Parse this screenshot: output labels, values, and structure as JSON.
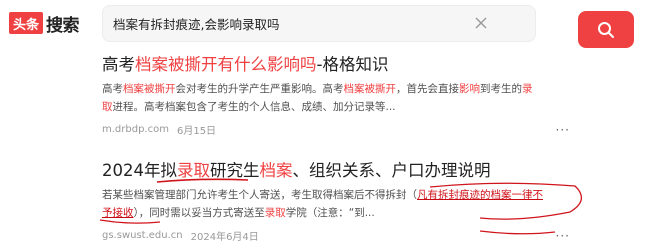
{
  "header": {
    "logo_box": "头条",
    "logo_text": "搜索",
    "search_value": "档案有拆封痕迹,会影响录取吗",
    "clear_icon": "close-icon",
    "search_icon": "search-icon"
  },
  "colors": {
    "accent": "#f04142",
    "annotation": "#d0141b"
  },
  "results": [
    {
      "title_segments": [
        {
          "text": "高考",
          "hl": false
        },
        {
          "text": "档案被撕开有什么影响吗",
          "hl": true
        },
        {
          "text": "-格格知识",
          "hl": false
        }
      ],
      "snippet_line1": [
        {
          "text": "高考",
          "hl": false
        },
        {
          "text": "档案被撕开",
          "hl": true
        },
        {
          "text": "会对考生的升学产生严重影响。高考",
          "hl": false
        },
        {
          "text": "档案被撕开",
          "hl": true
        },
        {
          "text": "，首先会直接",
          "hl": false
        },
        {
          "text": "影响",
          "hl": true
        },
        {
          "text": "到考生的",
          "hl": false
        },
        {
          "text": "录",
          "hl": true
        }
      ],
      "snippet_line2": [
        {
          "text": "取",
          "hl": true
        },
        {
          "text": "进程。高考档案包含了考生的个人信息、成绩、加分记录等...",
          "hl": false
        }
      ],
      "source": "m.drbdp.com",
      "date": "6月15日",
      "more": "···"
    },
    {
      "title_segments": [
        {
          "text": "2024年拟",
          "hl": false
        },
        {
          "text": "录取",
          "hl": true
        },
        {
          "text": "研究生",
          "hl": false
        },
        {
          "text": "档案",
          "hl": true
        },
        {
          "text": "、组织关系、户口办理说明",
          "hl": false
        }
      ],
      "snippet_line1_a": "若某些档案管理部门允许考生个人寄送，考生取得档案后不得拆封（",
      "snippet_line1_b": "凡有拆封痕迹的档案一律不",
      "snippet_line2_a": "予接收",
      "snippet_line2_b": "），同时需以妥当方式寄送至",
      "snippet_line2_c": "录取",
      "snippet_line2_d": "学院（注意：“到...",
      "source": "gs.swust.edu.cn",
      "date": "2024年6月4日",
      "more": "···"
    }
  ]
}
